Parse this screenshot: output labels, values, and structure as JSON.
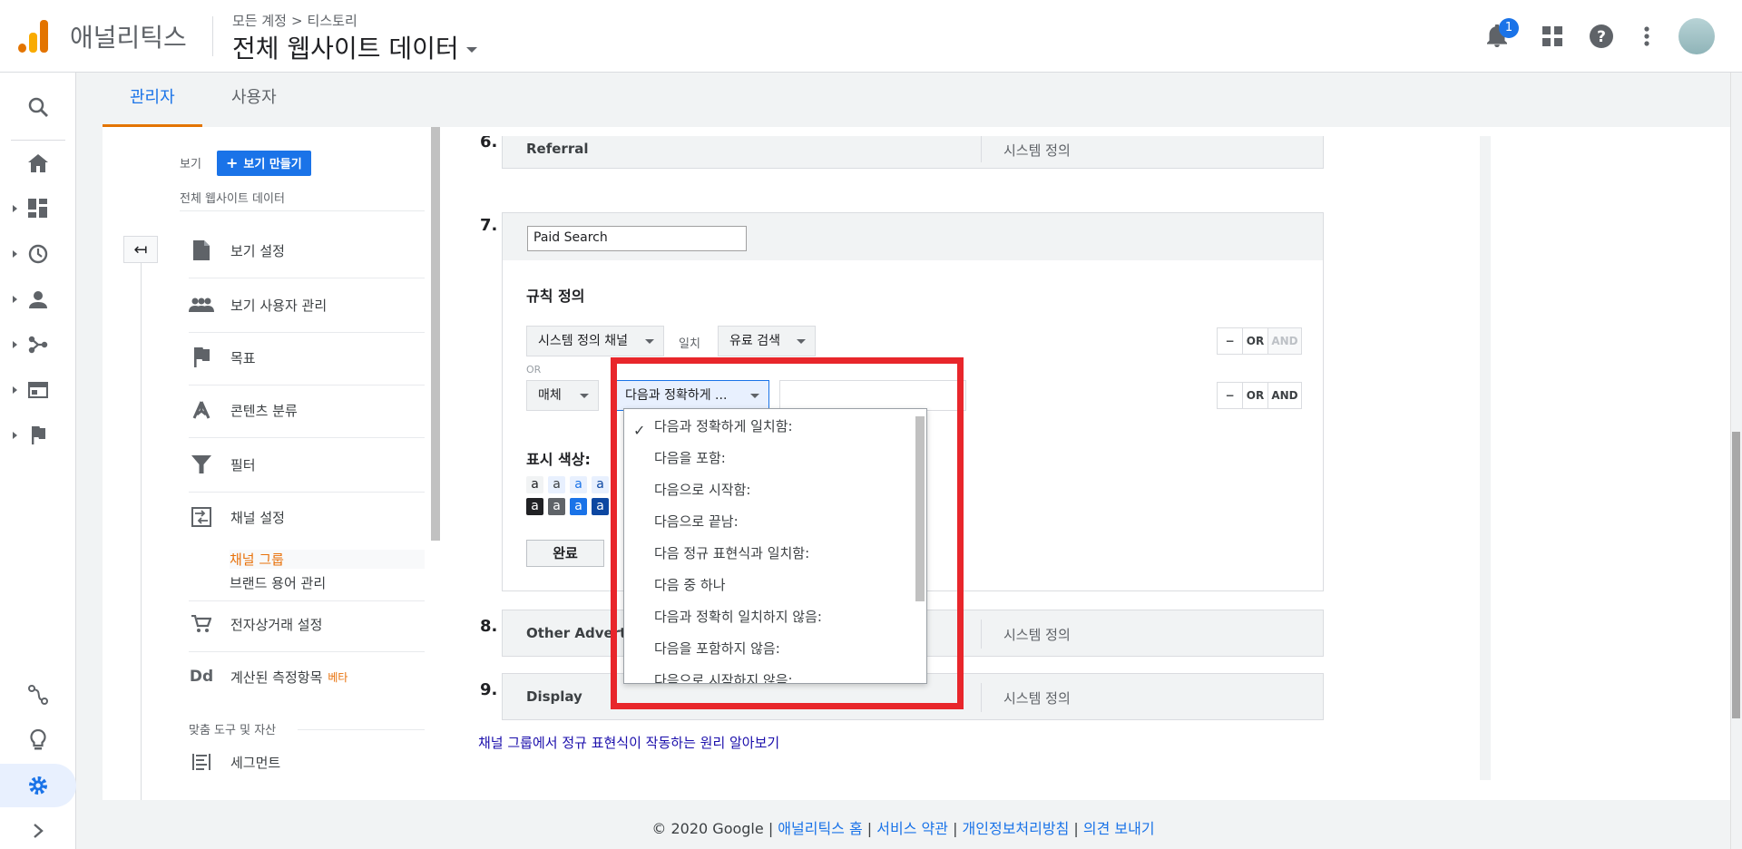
{
  "header": {
    "app_name": "애널리틱스",
    "breadcrumb": [
      "모든 계정",
      "티스토리"
    ],
    "breadcrumb_sep": ">",
    "view_title": "전체 웹사이트 데이터",
    "notification_count": "1"
  },
  "tabs": [
    {
      "label": "관리자",
      "active": true
    },
    {
      "label": "사용자",
      "active": false
    }
  ],
  "sidebar": {
    "view_label": "보기",
    "create_view_label": "보기 만들기",
    "view_name": "전체 웹사이트 데이터",
    "items": [
      {
        "label": "보기 설정",
        "icon": "document-icon"
      },
      {
        "label": "보기 사용자 관리",
        "icon": "people-icon"
      },
      {
        "label": "목표",
        "icon": "flag-icon"
      },
      {
        "label": "콘텐츠 분류",
        "icon": "content-grouping-icon"
      },
      {
        "label": "필터",
        "icon": "filter-icon"
      },
      {
        "label": "채널 설정",
        "icon": "channel-settings-icon"
      },
      {
        "label": "전자상거래 설정",
        "icon": "cart-icon"
      },
      {
        "label": "계산된 측정항목",
        "icon": "dd-icon",
        "badge": "베타"
      },
      {
        "label": "세그먼트",
        "icon": "segment-icon"
      }
    ],
    "sub_items": [
      {
        "label": "채널 그룹",
        "active": true
      },
      {
        "label": "브랜드 용어 관리",
        "active": false
      }
    ],
    "section_title": "맞춤 도구 및 자산",
    "dd_icon_text": "Dd"
  },
  "rows": [
    {
      "num": "6.",
      "name": "Referral",
      "type": "시스템 정의"
    },
    {
      "num": "7.",
      "name": "Paid Search"
    },
    {
      "num": "8.",
      "name": "Other Advertising",
      "type": "시스템 정의"
    },
    {
      "num": "9.",
      "name": "Display",
      "type": "시스템 정의"
    }
  ],
  "editor": {
    "channel_name_value": "Paid Search",
    "rule_title": "규칙 정의",
    "rule1": {
      "dimension": "시스템 정의 채널",
      "match_label": "일치",
      "value": "유료 검색"
    },
    "or_label": "OR",
    "rule2": {
      "dimension": "매체",
      "match": "다음과 정확하게 ...",
      "value": ""
    },
    "buttons": {
      "minus": "−",
      "or": "OR",
      "and": "AND"
    },
    "color_title": "표시 색상:",
    "swatch_letter": "a",
    "done_label": "완료",
    "help_link": "채널 그룹에서 정규 표현식이 작동하는 원리 알아보기"
  },
  "match_menu": {
    "selected": "다음과 정확하게 일치함:",
    "options": [
      "다음과 정확하게 일치함:",
      "다음을 포함:",
      "다음으로 시작함:",
      "다음으로 끝남:",
      "다음 정규 표현식과 일치함:",
      "다음 중 하나",
      "다음과 정확히 일치하지 않음:",
      "다음을 포함하지 않음:",
      "다음으로 시작하지 않음:"
    ]
  },
  "footer": {
    "copyright": "© 2020 Google",
    "links": [
      "애널리틱스 홈",
      "서비스 약관",
      "개인정보처리방침",
      "의견 보내기"
    ],
    "sep": "|"
  },
  "colors": {
    "accent": "#1a73e8",
    "tab_underline": "#e37400",
    "highlight": "#e8262b",
    "swatches_light": [
      "#f1f3f4",
      "#e8f0fe",
      "#e8f0fe",
      "#e8f0fe"
    ],
    "swatches_dark": [
      "#202124",
      "#5f6368",
      "#1a73e8",
      "#0d47a1"
    ]
  }
}
